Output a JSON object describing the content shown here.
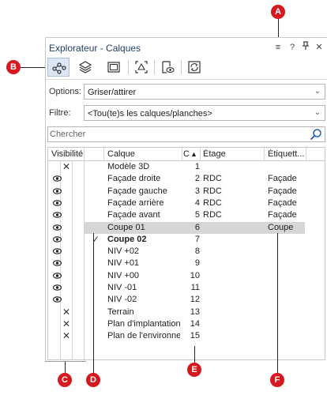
{
  "window": {
    "title": "Explorateur - Calques",
    "controls": [
      "≡",
      "?",
      "ᵖ",
      "✕"
    ]
  },
  "toolbar": {
    "tools": [
      "network-nodes-icon",
      "layers-icon",
      "sheet-frame-icon",
      "camera-view-icon",
      "visibility-sheet-icon",
      "sync-sheet-icon"
    ],
    "active_index": 0
  },
  "options": {
    "label": "Options:",
    "value": "Griser/attirer"
  },
  "filter": {
    "label": "Filtre:",
    "value": "<Tou(te)s les calques/planches>"
  },
  "search": {
    "placeholder": "Chercher"
  },
  "table": {
    "headers": {
      "visibility": "Visibilité",
      "calque": "Calque",
      "num": "C",
      "sort_arrow": "▲",
      "etage": "Étage",
      "etiquette": "Étiquett..."
    },
    "rows": [
      {
        "visible": false,
        "x": true,
        "check": false,
        "name": "Modèle 3D",
        "num": "1",
        "etage": "",
        "etiquette": "",
        "selected": false,
        "bold": false
      },
      {
        "visible": true,
        "x": false,
        "check": false,
        "name": "Façade droite",
        "num": "2",
        "etage": "RDC",
        "etiquette": "Façade",
        "selected": false,
        "bold": false
      },
      {
        "visible": true,
        "x": false,
        "check": false,
        "name": "Façade gauche",
        "num": "3",
        "etage": "RDC",
        "etiquette": "Façade",
        "selected": false,
        "bold": false
      },
      {
        "visible": true,
        "x": false,
        "check": false,
        "name": "Façade arrière",
        "num": "4",
        "etage": "RDC",
        "etiquette": "Façade",
        "selected": false,
        "bold": false
      },
      {
        "visible": true,
        "x": false,
        "check": false,
        "name": "Façade avant",
        "num": "5",
        "etage": "RDC",
        "etiquette": "Façade",
        "selected": false,
        "bold": false
      },
      {
        "visible": true,
        "x": false,
        "check": false,
        "name": "Coupe 01",
        "num": "6",
        "etage": "",
        "etiquette": "Coupe",
        "selected": true,
        "bold": false
      },
      {
        "visible": true,
        "x": false,
        "check": true,
        "name": "Coupe 02",
        "num": "7",
        "etage": "",
        "etiquette": "",
        "selected": false,
        "bold": true
      },
      {
        "visible": true,
        "x": false,
        "check": false,
        "name": "NIV +02",
        "num": "8",
        "etage": "",
        "etiquette": "",
        "selected": false,
        "bold": false
      },
      {
        "visible": true,
        "x": false,
        "check": false,
        "name": "NIV +01",
        "num": "9",
        "etage": "",
        "etiquette": "",
        "selected": false,
        "bold": false
      },
      {
        "visible": true,
        "x": false,
        "check": false,
        "name": "NIV +00",
        "num": "10",
        "etage": "",
        "etiquette": "",
        "selected": false,
        "bold": false
      },
      {
        "visible": true,
        "x": false,
        "check": false,
        "name": "NIV -01",
        "num": "11",
        "etage": "",
        "etiquette": "",
        "selected": false,
        "bold": false
      },
      {
        "visible": true,
        "x": false,
        "check": false,
        "name": "NIV -02",
        "num": "12",
        "etage": "",
        "etiquette": "",
        "selected": false,
        "bold": false
      },
      {
        "visible": false,
        "x": true,
        "check": false,
        "name": "Terrain",
        "num": "13",
        "etage": "",
        "etiquette": "",
        "selected": false,
        "bold": false
      },
      {
        "visible": false,
        "x": true,
        "check": false,
        "name": "Plan d'implantation",
        "num": "14",
        "etage": "",
        "etiquette": "",
        "selected": false,
        "bold": false
      },
      {
        "visible": false,
        "x": true,
        "check": false,
        "name": "Plan de l'environne...",
        "num": "15",
        "etage": "",
        "etiquette": "",
        "selected": false,
        "bold": false
      }
    ]
  },
  "callouts": {
    "a": "A",
    "b": "B",
    "c": "C",
    "d": "D",
    "e": "E",
    "f": "F"
  },
  "colors": {
    "callout": "#d6181f",
    "selection": "#d6d6d6",
    "title": "#1f3f6b",
    "active_tool": "#dce6f4"
  }
}
